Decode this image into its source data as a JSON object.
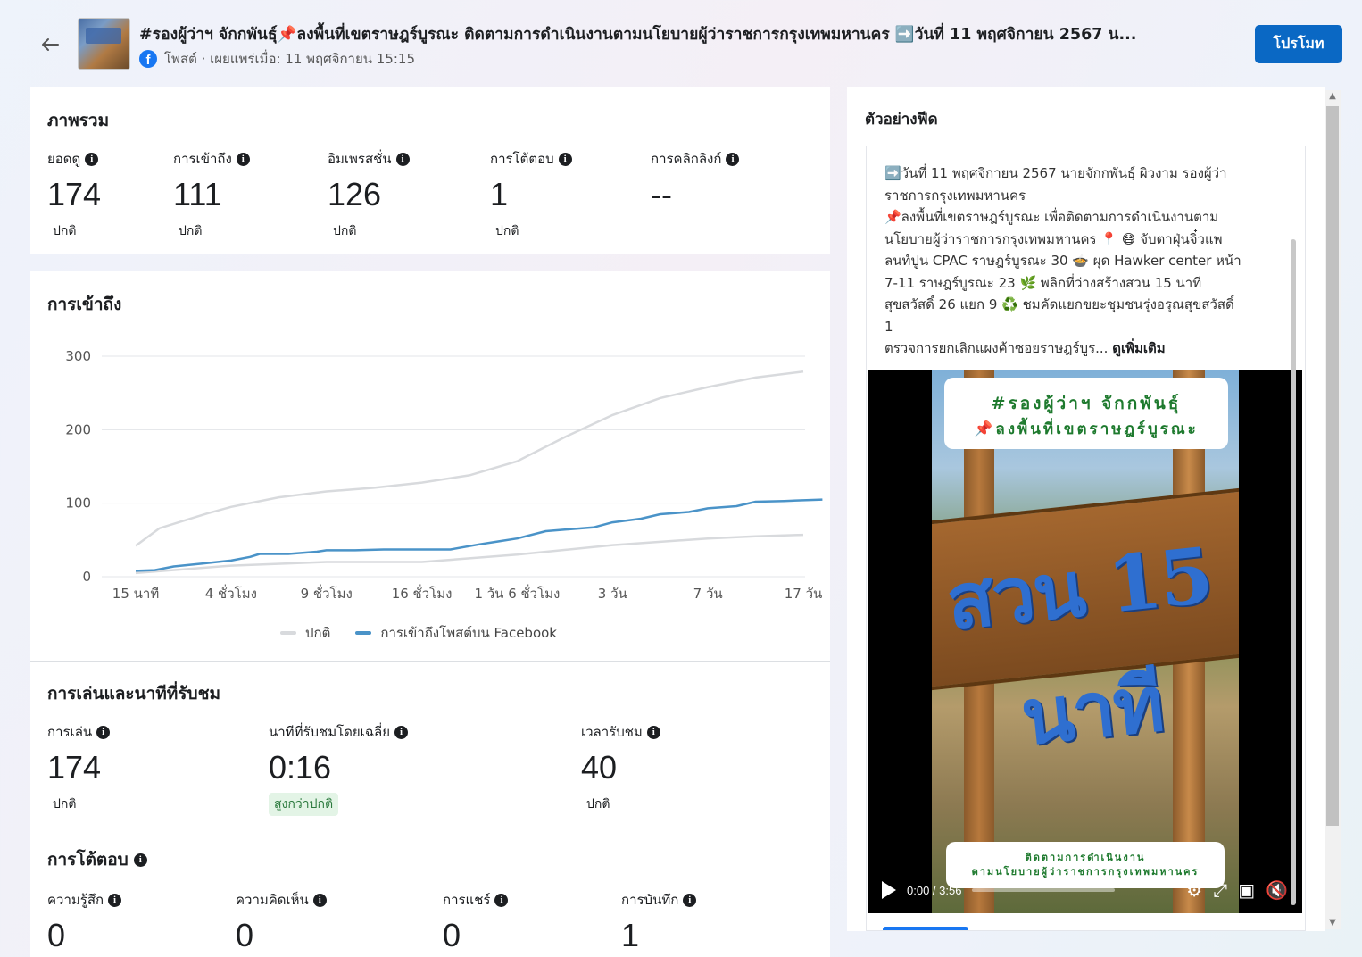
{
  "header": {
    "title": "#รองผู้ว่าฯ จักกพันธุ์📌ลงพื้นที่เขตราษฎร์บูรณะ ติดตามการดำเนินงานตามนโยบายผู้ว่าราชการกรุงเทพมหานคร ➡️วันที่ 11 พฤศจิกายน 2567 น...",
    "meta": "โพสต์ · เผยแพร่เมื่อ: 11 พฤศจิกายน 15:15",
    "promote_label": "โปรโมท",
    "icons": {
      "back": "back-arrow-icon",
      "source": "facebook-icon"
    }
  },
  "overview": {
    "title": "ภาพรวม",
    "stats": [
      {
        "label": "ยอดดู",
        "value": "174",
        "status": "ปกติ"
      },
      {
        "label": "การเข้าถึง",
        "value": "111",
        "status": "ปกติ"
      },
      {
        "label": "อิมเพรสชั่น",
        "value": "126",
        "status": "ปกติ"
      },
      {
        "label": "การโต้ตอบ",
        "value": "1",
        "status": "ปกติ"
      },
      {
        "label": "การคลิกลิงก์",
        "value": "--",
        "status": ""
      }
    ]
  },
  "reach": {
    "title": "การเข้าถึง",
    "legend": [
      "ปกติ",
      "การเข้าถึงโพสต์บน Facebook"
    ]
  },
  "chart_data": {
    "type": "line",
    "title": "การเข้าถึง",
    "x": [
      "15 นาที",
      "4 ชั่วโมง",
      "9 ชั่วโมง",
      "16 ชั่วโมง",
      "1 วัน 6 ชั่วโมง",
      "3 วัน",
      "7 วัน",
      "17 วัน"
    ],
    "y_ticks": [
      0,
      100,
      200,
      300
    ],
    "ylim": [
      0,
      300
    ],
    "grid": true,
    "legend_position": "bottom",
    "band": {
      "name": "ปกติ",
      "color": "#d8dadd",
      "upper": [
        [
          0,
          42
        ],
        [
          0.25,
          66
        ],
        [
          0.5,
          76
        ],
        [
          0.75,
          86
        ],
        [
          1,
          95
        ],
        [
          1.5,
          108
        ],
        [
          2,
          116
        ],
        [
          2.5,
          121
        ],
        [
          3,
          128
        ],
        [
          3.5,
          138
        ],
        [
          4,
          157
        ],
        [
          4.5,
          190
        ],
        [
          5,
          220
        ],
        [
          5.5,
          243
        ],
        [
          6,
          258
        ],
        [
          6.5,
          271
        ],
        [
          7,
          279
        ]
      ],
      "lower": [
        [
          0,
          5
        ],
        [
          1,
          15
        ],
        [
          2,
          20
        ],
        [
          3,
          20
        ],
        [
          4,
          30
        ],
        [
          5,
          43
        ],
        [
          6,
          52
        ],
        [
          6.5,
          55
        ],
        [
          7,
          57
        ]
      ]
    },
    "series": [
      {
        "name": "การเข้าถึงโพสต์บน Facebook",
        "color": "#4a93c8",
        "points": [
          [
            0,
            8
          ],
          [
            0.2,
            9
          ],
          [
            0.4,
            14
          ],
          [
            0.7,
            18
          ],
          [
            1,
            22
          ],
          [
            1.2,
            27
          ],
          [
            1.3,
            31
          ],
          [
            1.6,
            31
          ],
          [
            1.9,
            34
          ],
          [
            2,
            36
          ],
          [
            2.3,
            36
          ],
          [
            2.6,
            37
          ],
          [
            3,
            37
          ],
          [
            3.3,
            37
          ],
          [
            3.6,
            44
          ],
          [
            3.8,
            48
          ],
          [
            4,
            52
          ],
          [
            4.3,
            62
          ],
          [
            4.5,
            64
          ],
          [
            4.8,
            67
          ],
          [
            5,
            74
          ],
          [
            5.3,
            79
          ],
          [
            5.5,
            85
          ],
          [
            5.8,
            88
          ],
          [
            6,
            93
          ],
          [
            6.3,
            96
          ],
          [
            6.5,
            102
          ],
          [
            6.8,
            103
          ],
          [
            7.2,
            105
          ]
        ]
      }
    ]
  },
  "playback": {
    "title": "การเล่นและนาทีที่รับชม",
    "stats": [
      {
        "label": "การเล่น",
        "value": "174",
        "status": "ปกติ"
      },
      {
        "label": "นาทีที่รับชมโดยเฉลี่ย",
        "value": "0:16",
        "status": "สูงกว่าปกติ"
      },
      {
        "label": "เวลารับชม",
        "value": "40",
        "status": "ปกติ"
      }
    ]
  },
  "interactions": {
    "title": "การโต้ตอบ",
    "stats": [
      {
        "label": "ความรู้สึก",
        "value": "0"
      },
      {
        "label": "ความคิดเห็น",
        "value": "0"
      },
      {
        "label": "การแชร์",
        "value": "0"
      },
      {
        "label": "การบันทึก",
        "value": "1"
      }
    ]
  },
  "preview": {
    "title": "ตัวอย่างฟีด",
    "caption_lines": [
      "➡️วันที่ 11 พฤศจิกายน 2567 นายจักกพันธุ์ ผิวงาม รองผู้ว่า",
      "ราชการกรุงเทพมหานคร",
      "📌ลงพื้นที่เขตราษฎร์บูรณะ เพื่อติดตามการดำเนินงานตาม",
      "นโยบายผู้ว่าราชการกรุงเทพมหานคร 📍 😷 จับตาฝุ่นจิ๋วแพ",
      "ลนท์ปูน CPAC ราษฎร์บูรณะ 30 🍲 ผุด Hawker center หน้า",
      "7-11 ราษฎร์บูรณะ 23 🌿 พลิกที่ว่างสร้างสวน 15 นาที",
      "สุขสวัสดิ์ 26 แยก 9 ♻️ ชมคัดแยกขยะชุมชนรุ่งอรุณสุขสวัสดิ์",
      "1"
    ],
    "caption_last": "ตรวจการยกเลิกแผงค้าซอยราษฎร์บูร...",
    "see_more": "ดูเพิ่มเติม",
    "video": {
      "overlay_top_line1": "#รองผู้ว่าฯ จักกพันธุ์",
      "overlay_top_line2": "📌ลงพื้นที่เขตราษฎร์บูรณะ",
      "sign_text": "สวน 15 นาที",
      "overlay_bottom_line1": "ติดตามการดำเนินงาน",
      "overlay_bottom_line2": "ตามนโยบายผู้ว่าราชการกรุงเทพมหานคร",
      "time": "0:00 / 3:56",
      "progress": 0
    }
  }
}
